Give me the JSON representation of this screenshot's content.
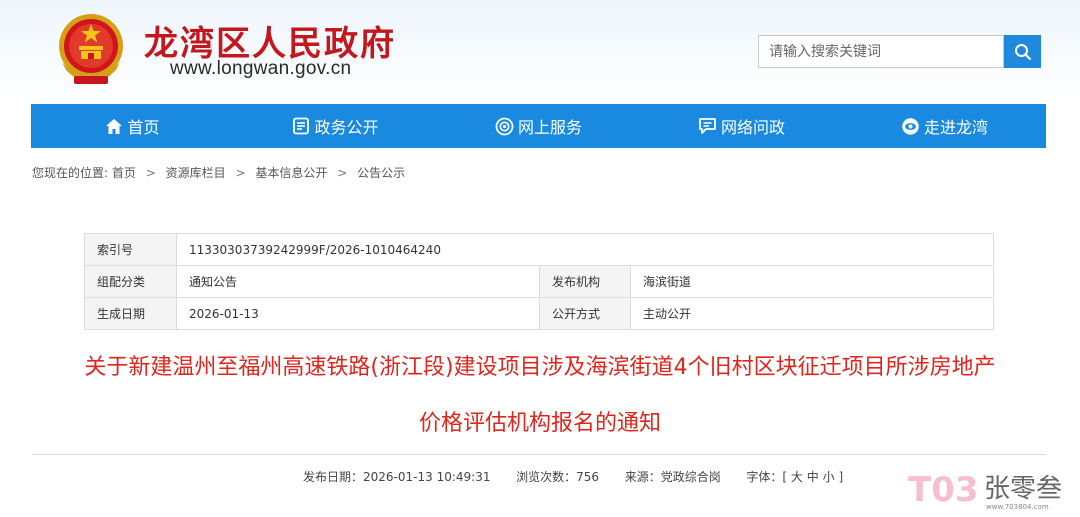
{
  "header": {
    "title": "龙湾区人民政府",
    "url": "www.longwan.gov.cn",
    "search_placeholder": "请输入搜索关键词",
    "emblem_icon": "national-emblem-icon",
    "search_icon": "search-icon"
  },
  "nav": {
    "items": [
      {
        "label": "首页",
        "icon": "home-icon"
      },
      {
        "label": "政务公开",
        "icon": "document-icon"
      },
      {
        "label": "网上服务",
        "icon": "service-icon"
      },
      {
        "label": "网络问政",
        "icon": "chat-icon"
      },
      {
        "label": "走进龙湾",
        "icon": "eye-icon"
      }
    ]
  },
  "breadcrumb": {
    "prefix": "您现在的位置:",
    "items": [
      "首页",
      "资源库栏目",
      "基本信息公开",
      "公告公示"
    ],
    "separator": ">"
  },
  "info": {
    "index_label": "索引号",
    "index_value": "11330303739242999F/2026-1010464240",
    "category_label": "组配分类",
    "category_value": "通知公告",
    "publisher_label": "发布机构",
    "publisher_value": "海滨街道",
    "date_label": "生成日期",
    "date_value": "2026-01-13",
    "method_label": "公开方式",
    "method_value": "主动公开"
  },
  "article": {
    "title_line1": "关于新建温州至福州高速铁路(浙江段)建设项目涉及海滨街道4个旧村区块征迁项目所涉房地产",
    "title_line2": "价格评估机构报名的通知"
  },
  "meta": {
    "publish_label": "发布日期：",
    "publish_value": "2026-01-13 10:49:31",
    "views_label": "浏览次数：",
    "views_value": "756",
    "source_label": "来源：",
    "source_value": "党政综合岗",
    "font_label": "字体：",
    "font_open": "[",
    "font_large": "大",
    "font_medium": "中",
    "font_small": "小",
    "font_close": "]"
  },
  "watermark": {
    "text": "张零叁",
    "logo_text": "T03",
    "small_url": "www.703804.com"
  },
  "colors": {
    "brand_red": "#c4161c",
    "nav_blue": "#1a8ae0",
    "title_red": "#e0251d",
    "search_blue": "#1e89dd"
  }
}
